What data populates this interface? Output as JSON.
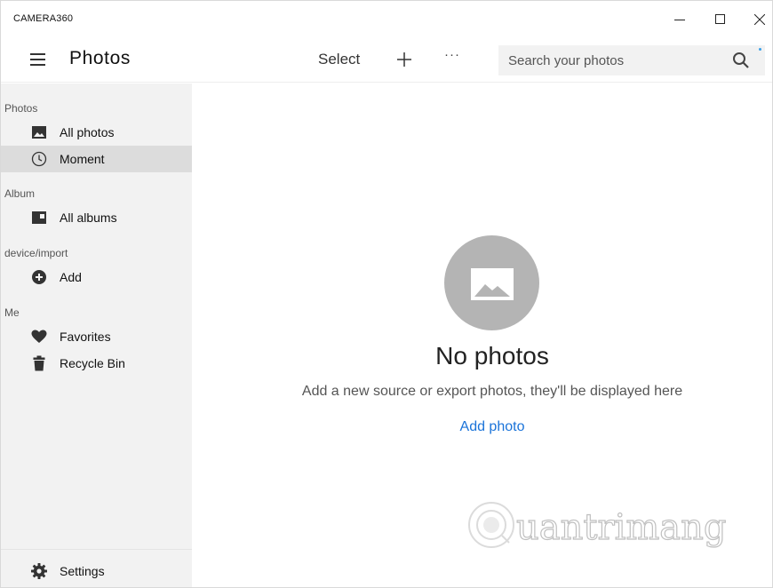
{
  "window": {
    "app_title": "CAMERA360"
  },
  "header": {
    "title": "Photos",
    "select_label": "Select",
    "more_label": "···",
    "search_placeholder": "Search your photos"
  },
  "sidebar": {
    "sections": [
      {
        "label": "Photos",
        "items": [
          {
            "label": "All photos",
            "icon": "image-icon"
          },
          {
            "label": "Moment",
            "icon": "clock-icon",
            "active": true
          }
        ]
      },
      {
        "label": "Album",
        "items": [
          {
            "label": "All albums",
            "icon": "album-icon"
          }
        ]
      },
      {
        "label": "device/import",
        "items": [
          {
            "label": "Add",
            "icon": "add-circle-icon"
          }
        ]
      },
      {
        "label": "Me",
        "items": [
          {
            "label": "Favorites",
            "icon": "heart-icon"
          },
          {
            "label": "Recycle Bin",
            "icon": "trash-icon"
          }
        ]
      }
    ],
    "settings_label": "Settings"
  },
  "main": {
    "empty_title": "No photos",
    "empty_subtitle": "Add a new source or export photos, they'll be displayed here",
    "add_photo_label": "Add photo"
  },
  "watermark": {
    "text": "uantrimang"
  },
  "colors": {
    "accent": "#1a73d9",
    "sidebar_bg": "#f2f2f2",
    "active_item_bg": "#dcdcdc",
    "placeholder_circle": "#b4b4b4"
  }
}
